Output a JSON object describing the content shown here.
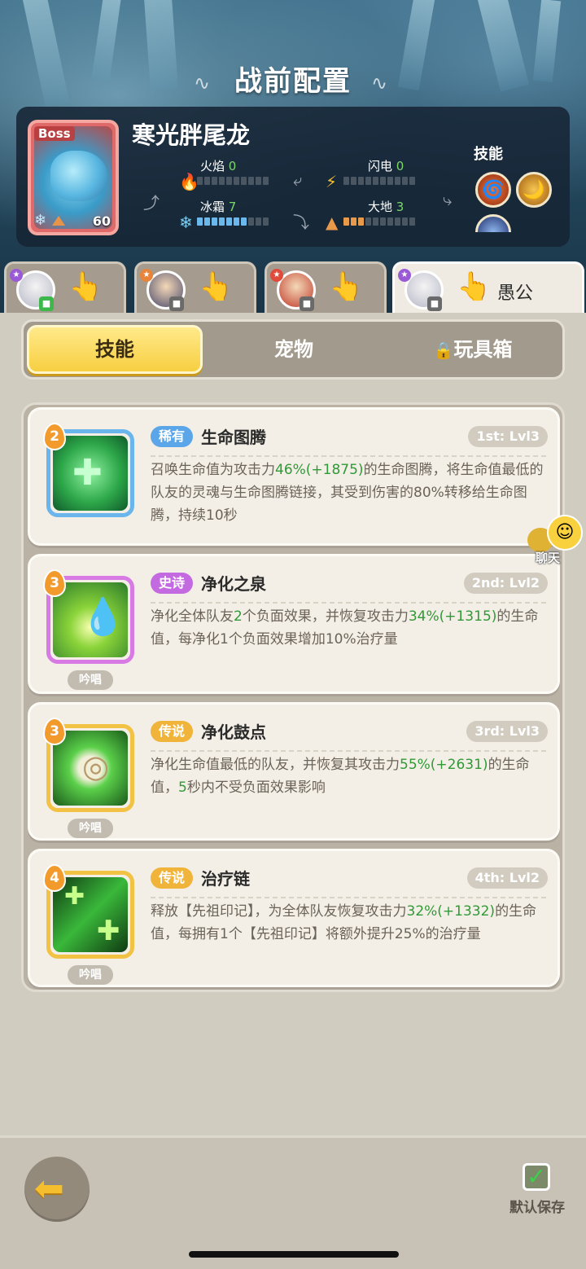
{
  "header": {
    "title": "战前配置"
  },
  "boss": {
    "tag": "Boss",
    "name": "寒光胖尾龙",
    "level": "60",
    "stats": [
      {
        "label": "火焰",
        "value": "0",
        "fill": 0,
        "icon": "fire-icon"
      },
      {
        "label": "闪电",
        "value": "0",
        "fill": 0,
        "icon": "lightning-icon"
      },
      {
        "label": "冰霜",
        "value": "7",
        "fill": 7,
        "icon": "snowflake-icon"
      },
      {
        "label": "大地",
        "value": "3",
        "fill": 3,
        "icon": "earth-icon"
      }
    ],
    "skills_label": "技能"
  },
  "hero_tabs": [
    {
      "elem": "purple",
      "badge": "green",
      "active": false
    },
    {
      "elem": "orange",
      "badge": "gray",
      "active": false
    },
    {
      "elem": "red",
      "badge": "gray",
      "active": false
    },
    {
      "elem": "purple",
      "badge": "gray",
      "active": true,
      "player_name": "愚公"
    }
  ],
  "segments": {
    "skills": "技能",
    "pets": "宠物",
    "toybox": "玩具箱"
  },
  "skills": [
    {
      "order": "2",
      "rarity": "稀有",
      "rarity_color": "#5aa6e8",
      "name": "生命图腾",
      "rank": "1st: Lvl3",
      "desc_parts": [
        "召唤生命值为攻击力",
        "46%(+1875)",
        "的生命图腾，将生命值最低的队友的灵魂与生命图腾链接，其受到伤害的80%转移给生命图腾，持续10秒"
      ],
      "chant": ""
    },
    {
      "order": "3",
      "rarity": "史诗",
      "rarity_color": "#c46ae0",
      "name": "净化之泉",
      "rank": "2nd: Lvl2",
      "desc_parts": [
        "净化全体队友",
        "2",
        "个负面效果，并恢复攻击力",
        "34%(+1315)",
        "的生命值，每净化1个负面效果增加10%治疗量"
      ],
      "chant": "吟唱"
    },
    {
      "order": "3",
      "rarity": "传说",
      "rarity_color": "#f0b43a",
      "name": "净化鼓点",
      "rank": "3rd: Lvl3",
      "desc_parts": [
        "净化生命值最低的队友，并恢复其攻击力",
        "55%(+2631)",
        "的生命值，",
        "5",
        "秒内不受负面效果影响"
      ],
      "chant": "吟唱"
    },
    {
      "order": "4",
      "rarity": "传说",
      "rarity_color": "#f0b43a",
      "name": "治疗链",
      "rank": "4th: Lvl2",
      "desc_parts": [
        "释放【先祖印记】，为全体队友恢复攻击力",
        "32%(+1332)",
        "的生命值，每拥有1个【先祖印记】将额外提升25%的治疗量"
      ],
      "chant": "吟唱"
    }
  ],
  "chat": {
    "label": "聊天"
  },
  "footer": {
    "default_save": "默认保存"
  },
  "colors": {
    "accent_yellow": "#f7cf41",
    "highlight_green": "#2f9a36",
    "panel_dark": "#16243a"
  }
}
